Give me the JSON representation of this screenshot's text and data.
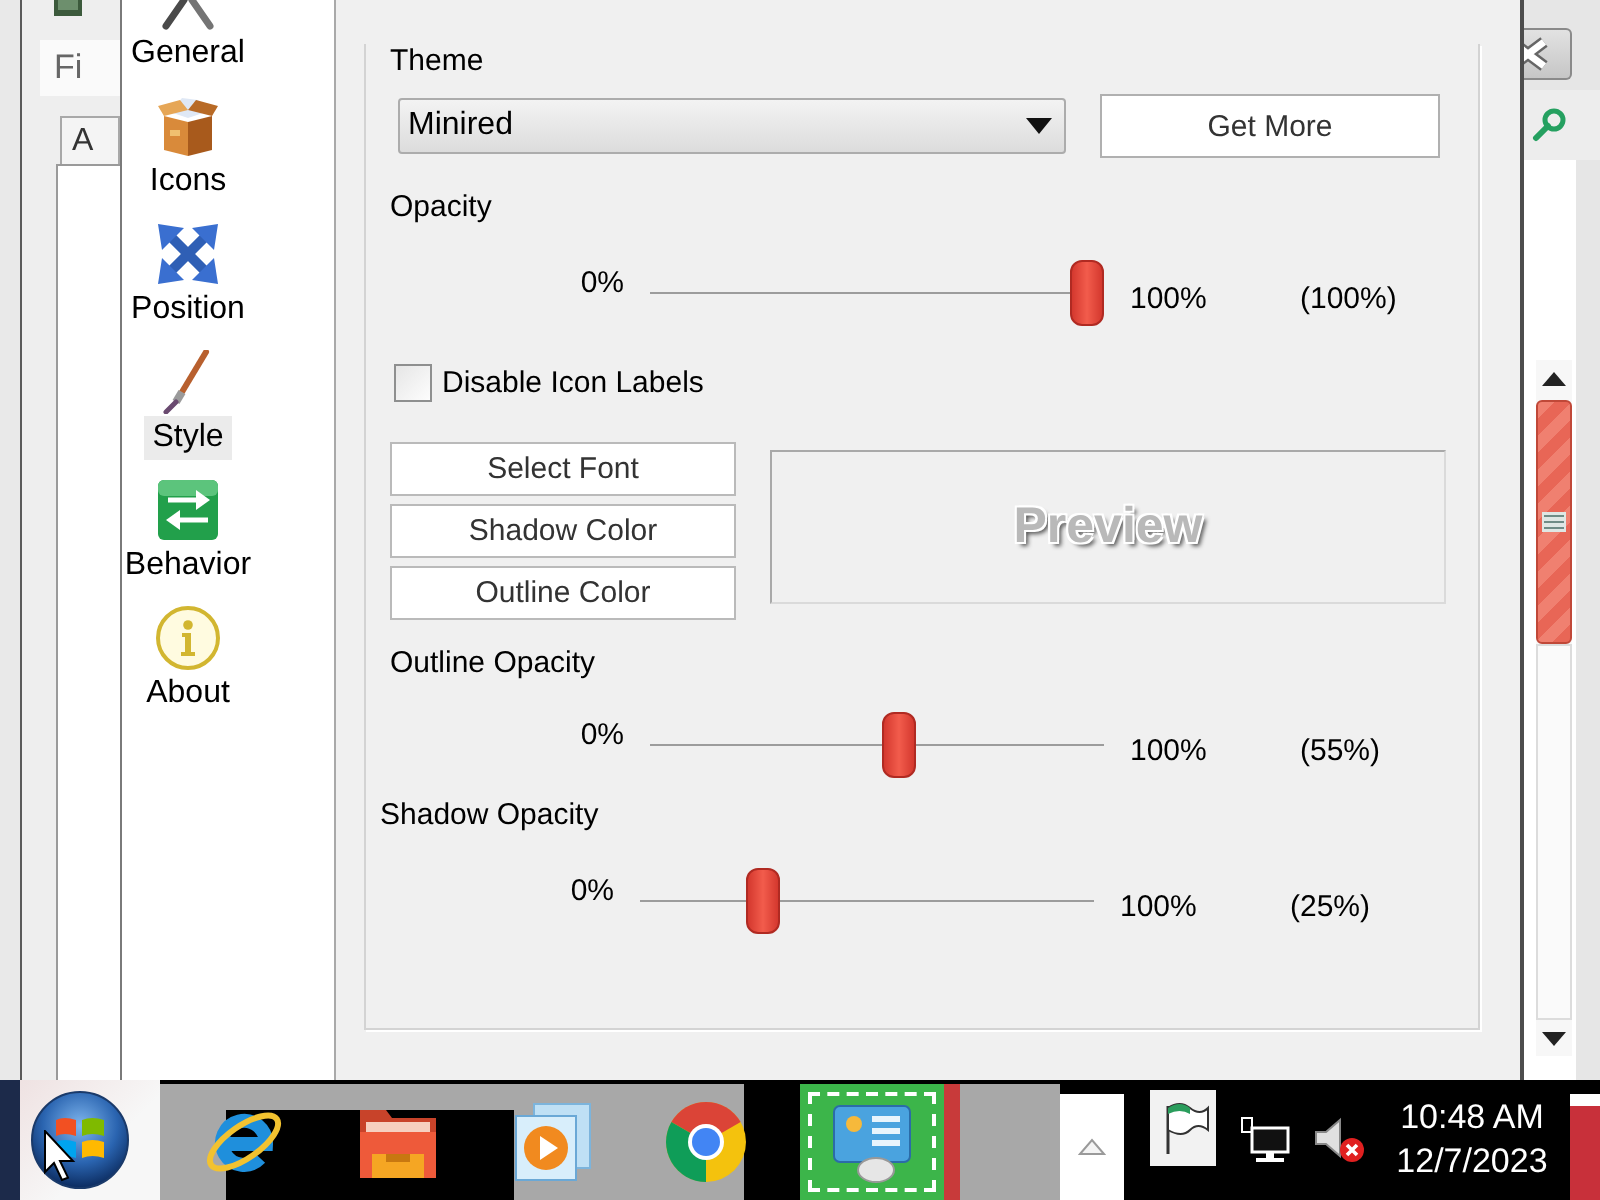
{
  "left_window": {
    "label": "Fi",
    "tab": "A"
  },
  "sidebar": {
    "items": [
      {
        "label": "General",
        "selected": false
      },
      {
        "label": "Icons",
        "selected": false
      },
      {
        "label": "Position",
        "selected": false
      },
      {
        "label": "Style",
        "selected": true
      },
      {
        "label": "Behavior",
        "selected": false
      },
      {
        "label": "About",
        "selected": false
      }
    ]
  },
  "style_panel": {
    "theme": {
      "label": "Theme",
      "value": "Minired",
      "button": "Get More"
    },
    "opacity": {
      "label": "Opacity",
      "min": "0%",
      "max": "100%",
      "level": 1,
      "reading": "(100%)"
    },
    "disable_icon_labels": {
      "label": "Disable Icon Labels",
      "checked": false
    },
    "font_buttons": [
      "Select Font",
      "Shadow Color",
      "Outline Color"
    ],
    "preview": {
      "text": "Preview"
    },
    "outline_opacity": {
      "label": "Outline Opacity",
      "min": "0%",
      "max": "100%",
      "level": 0.55,
      "reading": "(55%)"
    },
    "shadow_opacity": {
      "label": "Shadow Opacity",
      "min": "0%",
      "max": "100%",
      "level": 0.25,
      "reading": "(25%)"
    }
  },
  "taskbar": {
    "apps": [
      {
        "selected": false
      },
      {
        "selected": false
      },
      {
        "selected": false
      },
      {
        "selected": false
      },
      {
        "selected": true
      }
    ],
    "tray": {
      "volume_muted": true
    },
    "clock": {
      "time": "10:48 AM",
      "date": "12/7/2023"
    }
  }
}
